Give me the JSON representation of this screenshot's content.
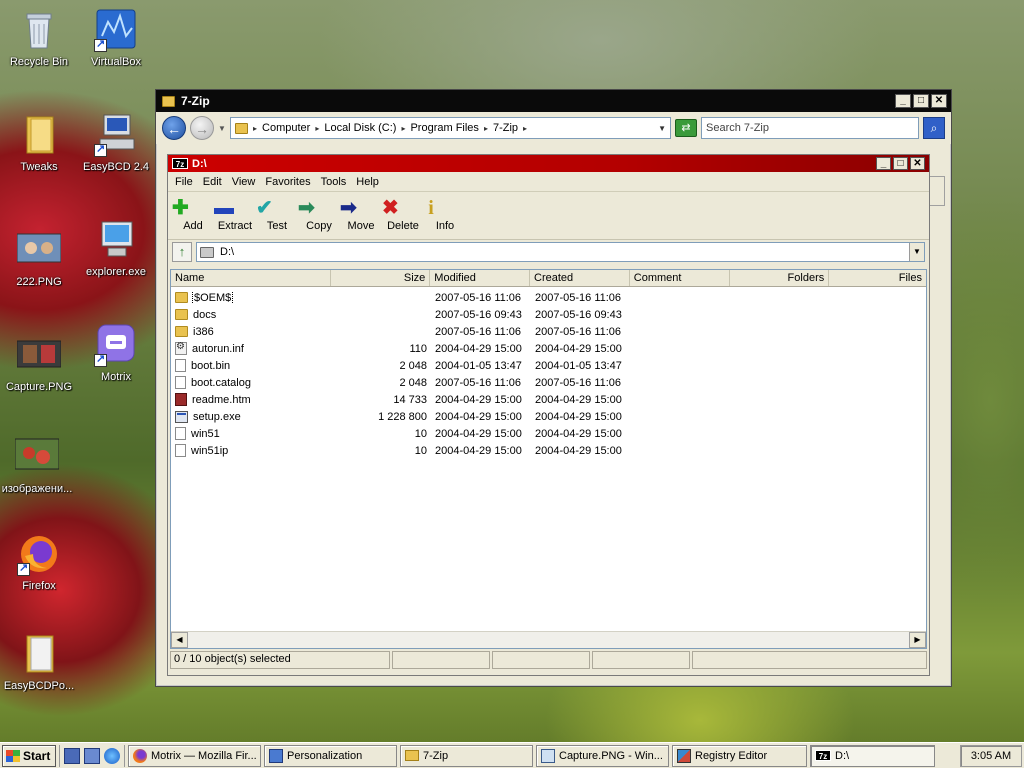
{
  "desktop": {
    "icons": [
      {
        "label": "Recycle Bin"
      },
      {
        "label": "VirtualBox"
      },
      {
        "label": "Tweaks"
      },
      {
        "label": "EasyBCD 2.4"
      },
      {
        "label": "222.PNG"
      },
      {
        "label": "explorer.exe"
      },
      {
        "label": "Capture.PNG"
      },
      {
        "label": "Motrix"
      },
      {
        "label": "изображени..."
      },
      {
        "label": "Firefox"
      },
      {
        "label": "EasyBCDPo..."
      }
    ]
  },
  "explorer": {
    "title": "7-Zip",
    "breadcrumbs": [
      "Computer",
      "Local Disk (C:)",
      "Program Files",
      "7-Zip"
    ],
    "search_placeholder": "Search 7-Zip"
  },
  "filemanager": {
    "title": "D:\\",
    "menu": [
      "File",
      "Edit",
      "View",
      "Favorites",
      "Tools",
      "Help"
    ],
    "toolbar": [
      {
        "label": "Add",
        "icon": "plus-icon",
        "color": "#22aa22"
      },
      {
        "label": "Extract",
        "icon": "minus-icon",
        "color": "#2244bb"
      },
      {
        "label": "Test",
        "icon": "check-icon",
        "color": "#22a6a6"
      },
      {
        "label": "Copy",
        "icon": "arrow-right-icon",
        "color": "#2a8a5a"
      },
      {
        "label": "Move",
        "icon": "arrow-right-icon",
        "color": "#1a2a8a"
      },
      {
        "label": "Delete",
        "icon": "x-icon",
        "color": "#d02020"
      },
      {
        "label": "Info",
        "icon": "info-icon",
        "color": "#c8a020"
      }
    ],
    "path": "D:\\",
    "columns": [
      "Name",
      "Size",
      "Modified",
      "Created",
      "Comment",
      "Folders",
      "Files"
    ],
    "files": [
      {
        "name": "$OEM$",
        "size": "",
        "modified": "2007-05-16 11:06",
        "created": "2007-05-16 11:06",
        "type": "folder"
      },
      {
        "name": "docs",
        "size": "",
        "modified": "2007-05-16 09:43",
        "created": "2007-05-16 09:43",
        "type": "folder"
      },
      {
        "name": "i386",
        "size": "",
        "modified": "2007-05-16 11:06",
        "created": "2007-05-16 11:06",
        "type": "folder"
      },
      {
        "name": "autorun.inf",
        "size": "110",
        "modified": "2004-04-29 15:00",
        "created": "2004-04-29 15:00",
        "type": "inf"
      },
      {
        "name": "boot.bin",
        "size": "2 048",
        "modified": "2004-01-05 13:47",
        "created": "2004-01-05 13:47",
        "type": "file"
      },
      {
        "name": "boot.catalog",
        "size": "2 048",
        "modified": "2007-05-16 11:06",
        "created": "2007-05-16 11:06",
        "type": "file"
      },
      {
        "name": "readme.htm",
        "size": "14 733",
        "modified": "2004-04-29 15:00",
        "created": "2004-04-29 15:00",
        "type": "htm"
      },
      {
        "name": "setup.exe",
        "size": "1 228 800",
        "modified": "2004-04-29 15:00",
        "created": "2004-04-29 15:00",
        "type": "exe"
      },
      {
        "name": "win51",
        "size": "10",
        "modified": "2004-04-29 15:00",
        "created": "2004-04-29 15:00",
        "type": "file"
      },
      {
        "name": "win51ip",
        "size": "10",
        "modified": "2004-04-29 15:00",
        "created": "2004-04-29 15:00",
        "type": "file"
      }
    ],
    "status": "0 / 10 object(s) selected"
  },
  "taskbar": {
    "start_label": "Start",
    "tasks": [
      {
        "label": "Motrix — Mozilla Fir...",
        "icon": "firefox-icon"
      },
      {
        "label": "Personalization",
        "icon": "monitor-icon"
      },
      {
        "label": "7-Zip",
        "icon": "folder-icon"
      },
      {
        "label": "Capture.PNG - Win...",
        "icon": "image-icon"
      },
      {
        "label": "Registry Editor",
        "icon": "registry-icon"
      },
      {
        "label": "D:\\",
        "icon": "7zip-icon"
      }
    ],
    "clock": "3:05 AM"
  }
}
